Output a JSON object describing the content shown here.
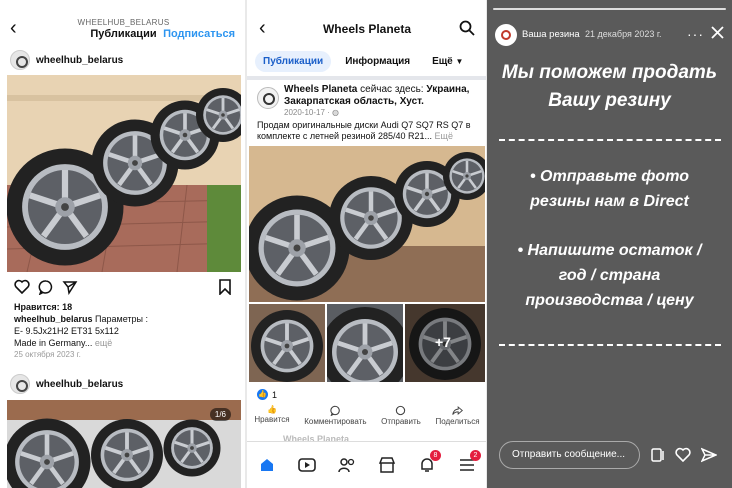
{
  "instagram": {
    "header_subtitle": "WHEELHUB_BELARUS",
    "header_title": "Публикации",
    "follow_label": "Подписаться",
    "post1": {
      "username": "wheelhub_belarus",
      "likes": "Нравится: 18",
      "caption_user": "wheelhub_belarus",
      "caption_line1": "Параметры :",
      "caption_line2": "E- 9.5Jx21H2 ET31 5x112",
      "caption_line3": "Made in Germany...",
      "more": "ещё",
      "date": "25 октября 2023 г."
    },
    "post2": {
      "username": "wheelhub_belarus",
      "counter": "1/6"
    },
    "icons": [
      "back-icon",
      "heart-icon",
      "comment-icon",
      "share-icon",
      "bookmark-icon"
    ]
  },
  "facebook": {
    "page_title": "Wheels Planeta",
    "tabs": [
      {
        "label": "Публикации",
        "active": true
      },
      {
        "label": "Информация",
        "active": false
      },
      {
        "label": "Ещё",
        "active": false
      }
    ],
    "post": {
      "author": "Wheels Planeta",
      "checkin_text": "сейчас здесь:",
      "location": "Украина, Закарпатская область, Хуст.",
      "date": "2020-10-17",
      "text": "Продам оригинальные диски Audi Q7 SQ7 RS Q7 в комплекте с летней резиной 285/40 R21...",
      "more": "Ещё",
      "extra_photos": "+7",
      "like_count": "1"
    },
    "actions": [
      "Нравится",
      "Комментировать",
      "Отправить",
      "Поделиться"
    ],
    "next_post_author": "Wheels Planeta",
    "nav_badges": {
      "notifications": "8",
      "menu": "2"
    }
  },
  "story": {
    "username": "Ваша резина",
    "date": "21 декабря 2023 г.",
    "line1": "Мы поможем продать",
    "line2": "Вашу резину",
    "bullet1_line1": "• Отправьте фото",
    "bullet1_line2": "резины нам в Direct",
    "bullet2_line1": "• Напишите остаток /",
    "bullet2_line2": "год / страна",
    "bullet2_line3": "производства / цену",
    "reply_placeholder": "Отправить сообщение...",
    "background_color": "#5a5a5a"
  },
  "colors": {
    "instagram_link": "#2d95f0",
    "facebook_blue": "#1877f2",
    "fb_badge": "#e41e3f"
  }
}
